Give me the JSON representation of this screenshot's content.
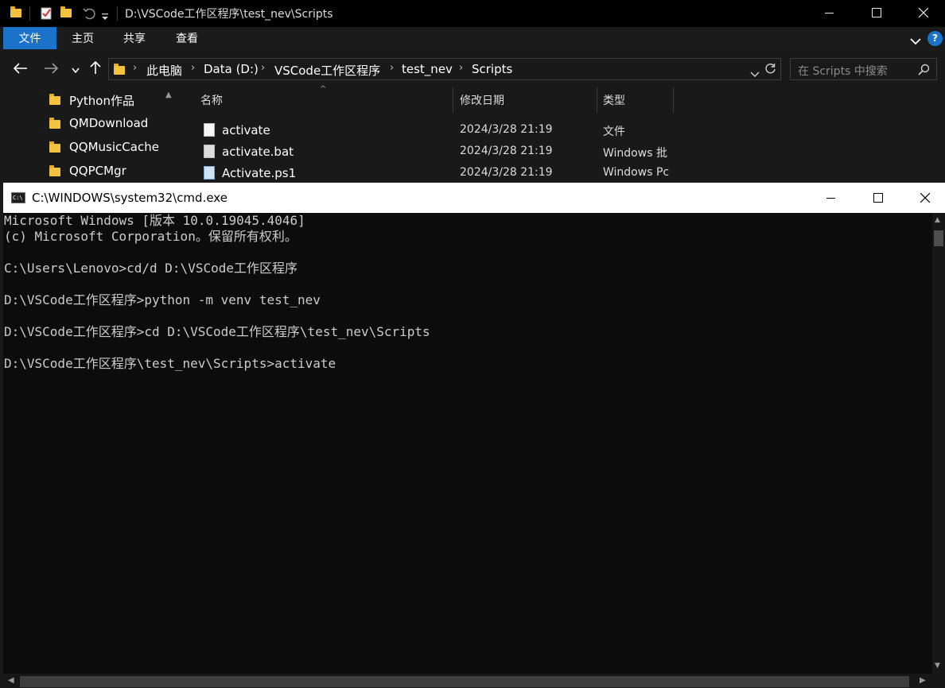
{
  "explorer": {
    "title": "D:\\VSCode工作区程序\\test_nev\\Scripts",
    "ribbon_tabs": [
      "文件",
      "主页",
      "共享",
      "查看"
    ],
    "address": [
      "此电脑",
      "Data (D:)",
      "VSCode工作区程序",
      "test_nev",
      "Scripts"
    ],
    "search_placeholder": "在 Scripts 中搜索",
    "nav_items": [
      "Python作品",
      "QMDownload",
      "QQMusicCache",
      "QQPCMgr"
    ],
    "columns": [
      "名称",
      "修改日期",
      "类型"
    ],
    "files": [
      {
        "name": "activate",
        "date": "2024/3/28 21:19",
        "type": "文件",
        "icon": "file-icon"
      },
      {
        "name": "activate.bat",
        "date": "2024/3/28 21:19",
        "type": "Windows 批",
        "icon": "batch-file-icon"
      },
      {
        "name": "Activate.ps1",
        "date": "2024/3/28 21:19",
        "type": "Windows Pc",
        "icon": "powershell-file-icon"
      }
    ]
  },
  "cmd": {
    "title": "C:\\WINDOWS\\system32\\cmd.exe",
    "icon_text": "C:\\",
    "lines": [
      "Microsoft Windows [版本 10.0.19045.4046]",
      "(c) Microsoft Corporation。保留所有权利。",
      "",
      "C:\\Users\\Lenovo>cd/d D:\\VSCode工作区程序",
      "",
      "D:\\VSCode工作区程序>python -m venv test_nev",
      "",
      "D:\\VSCode工作区程序>cd D:\\VSCode工作区程序\\test_nev\\Scripts",
      "",
      "D:\\VSCode工作区程序\\test_nev\\Scripts>activate"
    ]
  },
  "colors": {
    "accent": "#1a73c8",
    "console_bg": "#0c0c0c",
    "console_text": "#cccccc",
    "explorer_bg": "#191919"
  }
}
